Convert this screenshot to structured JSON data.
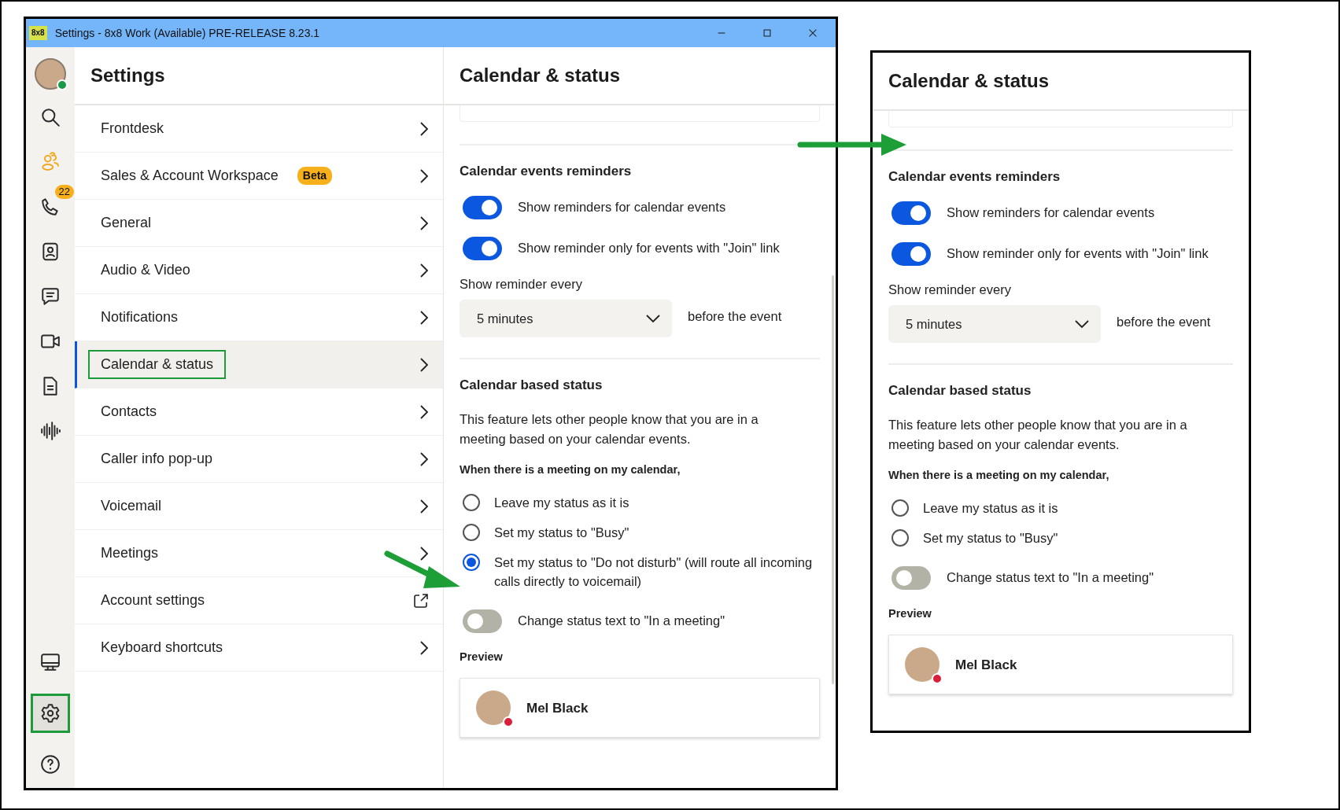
{
  "window": {
    "app_icon": "8x8",
    "title": "Settings - 8x8 Work (Available) PRE-RELEASE 8.23.1"
  },
  "rail": {
    "avatar": {
      "status_dot": {
        "color": "#1a9a45"
      }
    },
    "top_icons": [
      {
        "kind": "search",
        "accent": false
      },
      {
        "kind": "people",
        "accent": true
      },
      {
        "kind": "phone",
        "accent": false,
        "badge": "22"
      },
      {
        "kind": "contacts",
        "accent": false
      },
      {
        "kind": "chat",
        "accent": false
      },
      {
        "kind": "video",
        "accent": false
      },
      {
        "kind": "document",
        "accent": false
      },
      {
        "kind": "waveform",
        "accent": false
      }
    ],
    "bottom_icons": [
      {
        "kind": "monitor",
        "selected": false,
        "highlighted": false
      },
      {
        "kind": "gear",
        "selected": true,
        "highlighted": true
      },
      {
        "kind": "help",
        "selected": false,
        "highlighted": false
      }
    ]
  },
  "settings": {
    "title": "Settings",
    "items": [
      {
        "label": "Frontdesk",
        "kind": "chevron",
        "selected": false,
        "highlighted": false
      },
      {
        "label": "Sales & Account Workspace",
        "badge": "Beta",
        "kind": "chevron",
        "selected": false,
        "highlighted": false
      },
      {
        "label": "General",
        "kind": "chevron",
        "selected": false,
        "highlighted": false
      },
      {
        "label": "Audio & Video",
        "kind": "chevron",
        "selected": false,
        "highlighted": false
      },
      {
        "label": "Notifications",
        "kind": "chevron",
        "selected": false,
        "highlighted": false
      },
      {
        "label": "Calendar & status",
        "kind": "chevron",
        "selected": true,
        "highlighted": true
      },
      {
        "label": "Contacts",
        "kind": "chevron",
        "selected": false,
        "highlighted": false
      },
      {
        "label": "Caller info pop-up",
        "kind": "chevron",
        "selected": false,
        "highlighted": false
      },
      {
        "label": "Voicemail",
        "kind": "chevron",
        "selected": false,
        "highlighted": false
      },
      {
        "label": "Meetings",
        "kind": "chevron",
        "selected": false,
        "highlighted": false
      },
      {
        "label": "Account settings",
        "kind": "external",
        "selected": false,
        "highlighted": false
      },
      {
        "label": "Keyboard shortcuts",
        "kind": "chevron",
        "selected": false,
        "highlighted": false
      }
    ]
  },
  "panels": [
    {
      "title": "Calendar & status",
      "reminders_heading": "Calendar events reminders",
      "toggles": [
        {
          "label": "Show reminders for calendar events",
          "on": true
        },
        {
          "label": "Show reminder only for events with \"Join\" link",
          "on": true
        }
      ],
      "reminder_label": "Show reminder every",
      "reminder_value": "5 minutes",
      "reminder_suffix": "before the event",
      "status_heading": "Calendar based status",
      "description": "This feature lets other people know that you are in a meeting based on your calendar events.",
      "question": "When there is a meeting on my calendar,",
      "options": [
        {
          "label": "Leave my status as it is",
          "selected": false
        },
        {
          "label": "Set my status to \"Busy\"",
          "selected": false
        },
        {
          "label": "Set my status to \"Do not disturb\" (will route all incoming calls directly to voicemail)",
          "selected": true
        }
      ],
      "status_text_toggle": {
        "label": "Change status text to \"In a meeting\"",
        "on": false
      },
      "preview_label": "Preview",
      "preview": {
        "name": "Mel Black",
        "status_dot": {
          "color": "#d9203b"
        }
      }
    },
    {
      "title": "Calendar & status",
      "reminders_heading": "Calendar events reminders",
      "toggles": [
        {
          "label": "Show reminders for calendar events",
          "on": true
        },
        {
          "label": "Show reminder only for events with \"Join\" link",
          "on": true
        }
      ],
      "reminder_label": "Show reminder every",
      "reminder_value": "5 minutes",
      "reminder_suffix": "before the event",
      "status_heading": "Calendar based status",
      "description": "This feature lets other people know that you are in a meeting based on your calendar events.",
      "question": "When there is a meeting on my calendar,",
      "options": [
        {
          "label": "Leave my status as it is",
          "selected": false
        },
        {
          "label": "Set my status to \"Busy\"",
          "selected": false
        }
      ],
      "status_text_toggle": {
        "label": "Change status text to \"In a meeting\"",
        "on": false
      },
      "preview_label": "Preview",
      "preview": {
        "name": "Mel Black",
        "status_dot": {
          "color": "#d9203b"
        }
      }
    }
  ]
}
